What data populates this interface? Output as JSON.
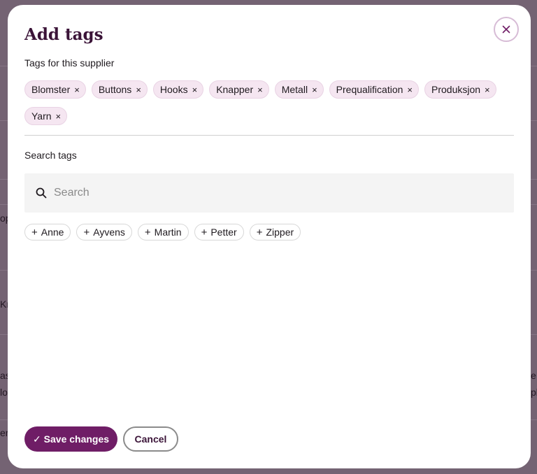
{
  "background": {
    "fragments": [
      "op",
      "Kn",
      "as",
      "lo",
      "e.",
      "pl",
      "er"
    ]
  },
  "dialog": {
    "title": "Add tags",
    "close_icon": "close-icon",
    "current_tags_label": "Tags for this supplier",
    "tags": [
      {
        "label": "Blomster"
      },
      {
        "label": "Buttons"
      },
      {
        "label": "Hooks"
      },
      {
        "label": "Knapper"
      },
      {
        "label": "Metall"
      },
      {
        "label": "Prequalification"
      },
      {
        "label": "Produksjon"
      },
      {
        "label": "Yarn"
      }
    ],
    "remove_glyph": "×",
    "search_label": "Search tags",
    "search": {
      "placeholder": "Search",
      "value": "",
      "icon": "search-icon"
    },
    "suggestions": [
      {
        "label": "Anne"
      },
      {
        "label": "Ayvens"
      },
      {
        "label": "Martin"
      },
      {
        "label": "Petter"
      },
      {
        "label": "Zipper"
      }
    ],
    "add_glyph": "+",
    "save_label": "Save changes",
    "save_icon": "✓",
    "cancel_label": "Cancel"
  },
  "colors": {
    "accent": "#6f1d66",
    "title": "#3b1438",
    "tag_bg": "#f5e6f1",
    "overlay": "#746373"
  }
}
